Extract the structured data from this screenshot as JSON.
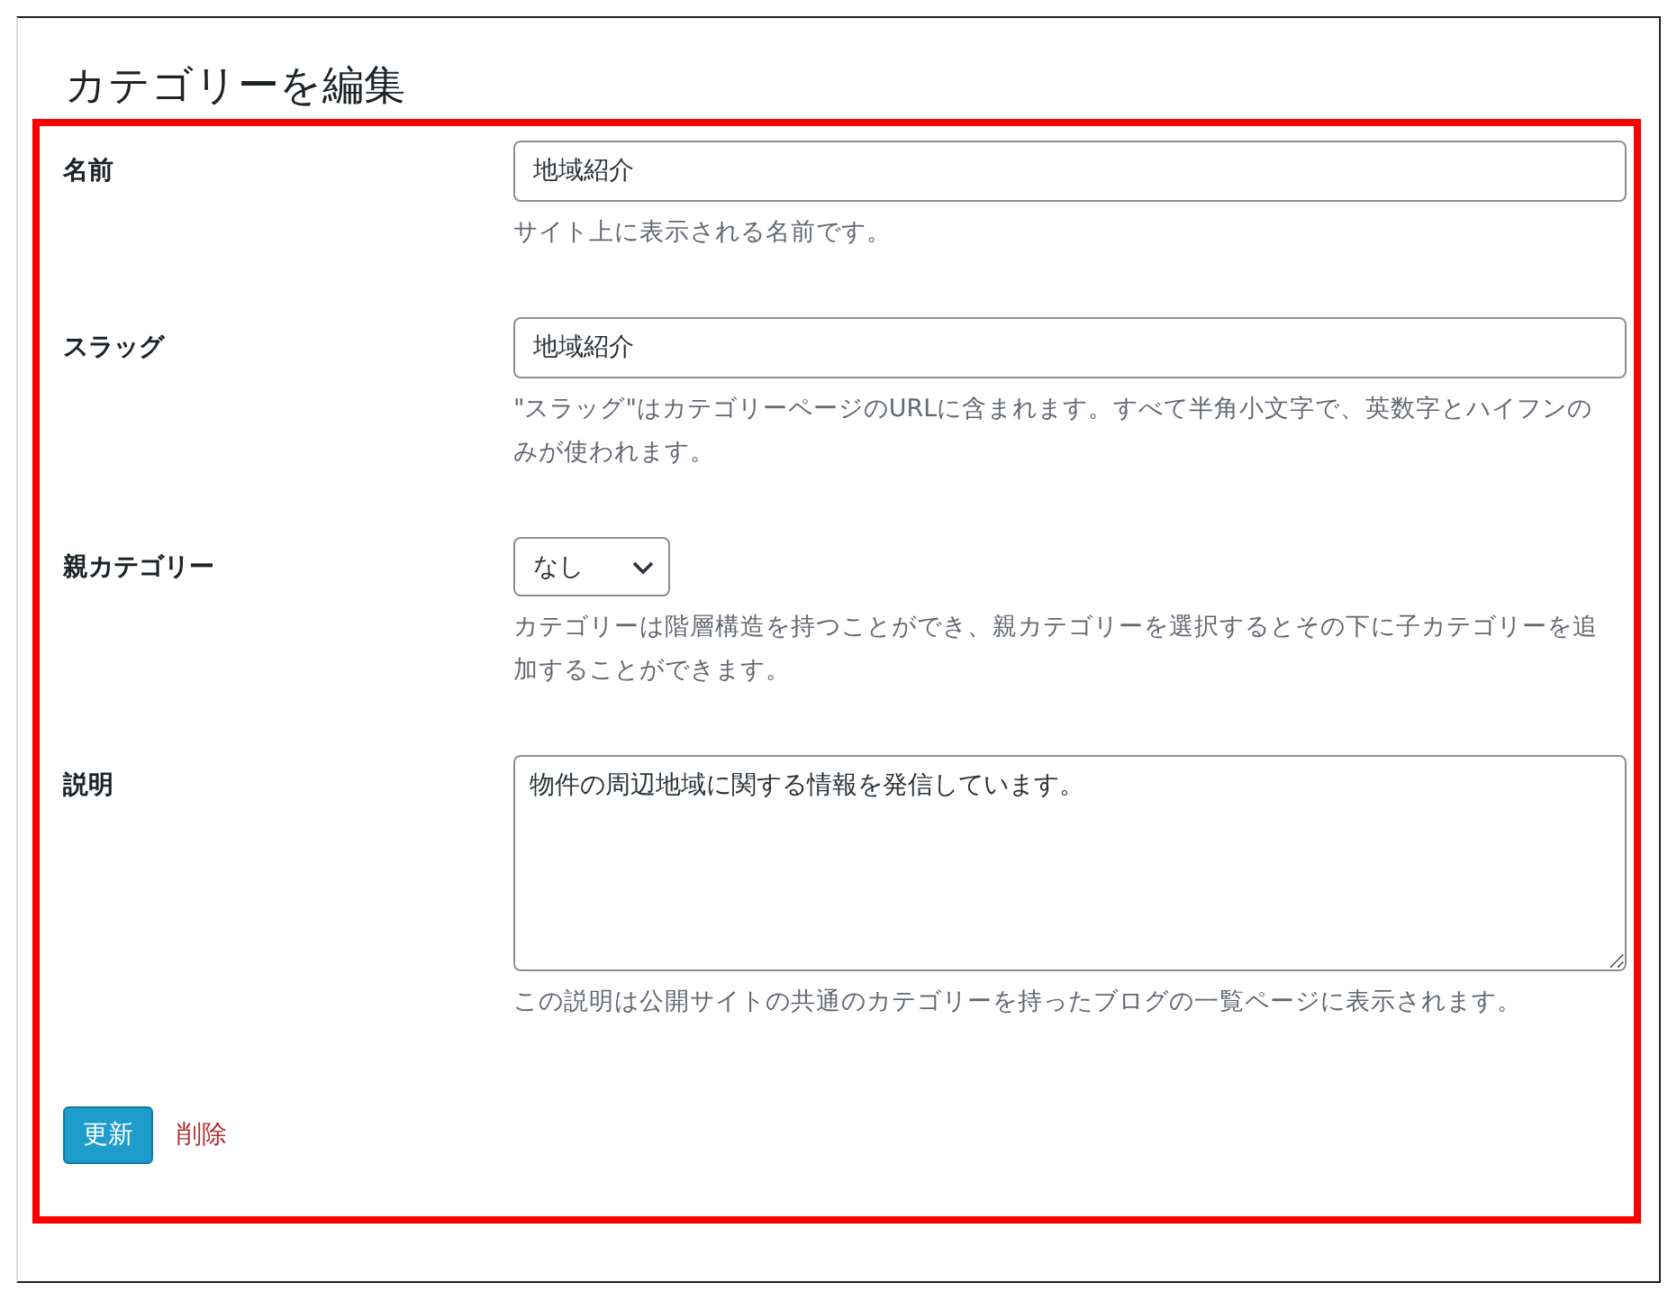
{
  "page": {
    "title": "カテゴリーを編集"
  },
  "fields": [
    {
      "kind": "text",
      "label": "名前",
      "value": "地域紹介",
      "description": "サイト上に表示される名前です。"
    },
    {
      "kind": "text",
      "label": "スラッグ",
      "value": "地域紹介",
      "description": "\"スラッグ\"はカテゴリーページのURLに含まれます。すべて半角小文字で、英数字とハイフンのみが使われます。"
    },
    {
      "kind": "select",
      "label": "親カテゴリー",
      "value": "なし",
      "description": "カテゴリーは階層構造を持つことができ、親カテゴリーを選択するとその下に子カテゴリーを追加することができます。"
    },
    {
      "kind": "textarea",
      "label": "説明",
      "value": "物件の周辺地域に関する情報を発信しています。",
      "description": "この説明は公開サイトの共通のカテゴリーを持ったブログの一覧ページに表示されます。"
    }
  ],
  "actions": {
    "update_button": "更新",
    "delete_link": "削除"
  }
}
